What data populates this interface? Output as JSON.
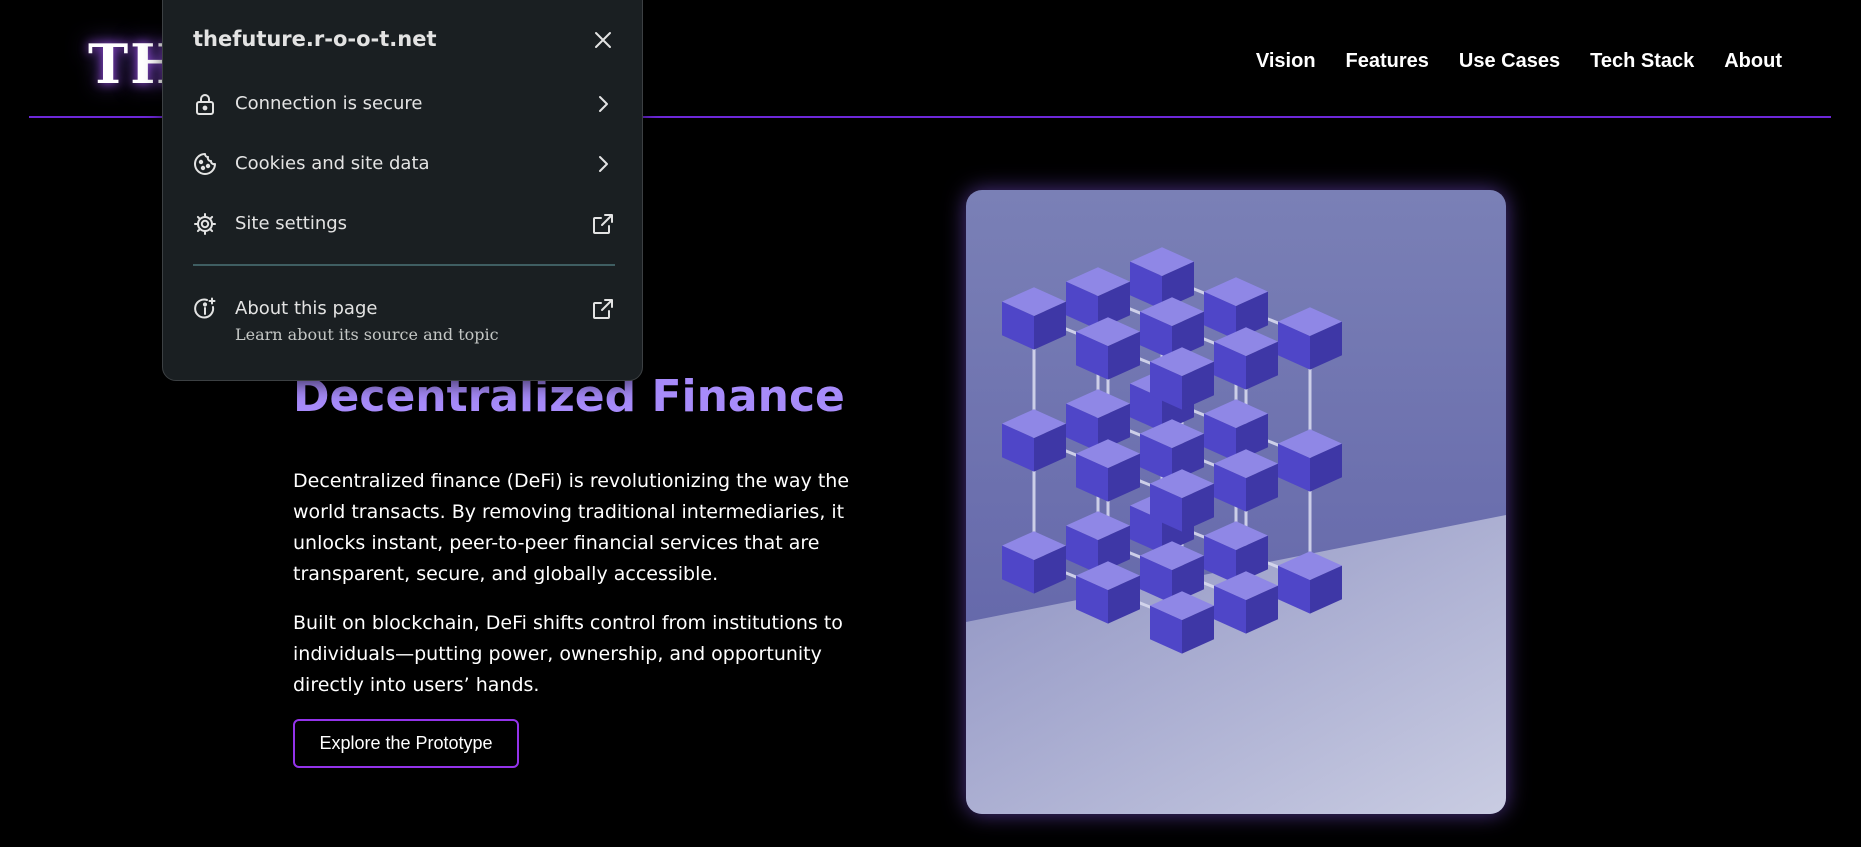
{
  "header": {
    "logo_text": "THE FUTURE",
    "nav": [
      "Vision",
      "Features",
      "Use Cases",
      "Tech Stack",
      "About"
    ]
  },
  "hero": {
    "title": "Decentralized Finance",
    "paragraph1": "Decentralized finance (DeFi) is revolutionizing the way the world transacts. By removing traditional intermediaries, it unlocks instant, peer-to-peer financial services that are transparent, secure, and globally accessible.",
    "paragraph2": "Built on blockchain, DeFi shifts control from institutions to individuals—putting power, ownership, and opportunity directly into users’ hands.",
    "cta_label": "Explore the Prototype",
    "image_icon": "blockchain-cube-lattice-image"
  },
  "site_info_popup": {
    "host": "thefuture.r-o-o-t.net",
    "items": [
      {
        "label": "Connection is secure",
        "icon": "lock-icon",
        "trailing": "chevron-right-icon"
      },
      {
        "label": "Cookies and site data",
        "icon": "cookie-icon",
        "trailing": "chevron-right-icon"
      },
      {
        "label": "Site settings",
        "icon": "gear-icon",
        "trailing": "external-link-icon"
      }
    ],
    "about": {
      "label": "About this page",
      "sublabel": "Learn about its source and topic",
      "icon": "info-sparkle-icon",
      "trailing": "external-link-icon"
    }
  },
  "colors": {
    "background": "#000000",
    "accent": "#a78bfa",
    "header_line": "#6d28d9",
    "button_border": "#9333ea",
    "popup_bg": "#1a1f22",
    "cube": "#4f46c8"
  }
}
